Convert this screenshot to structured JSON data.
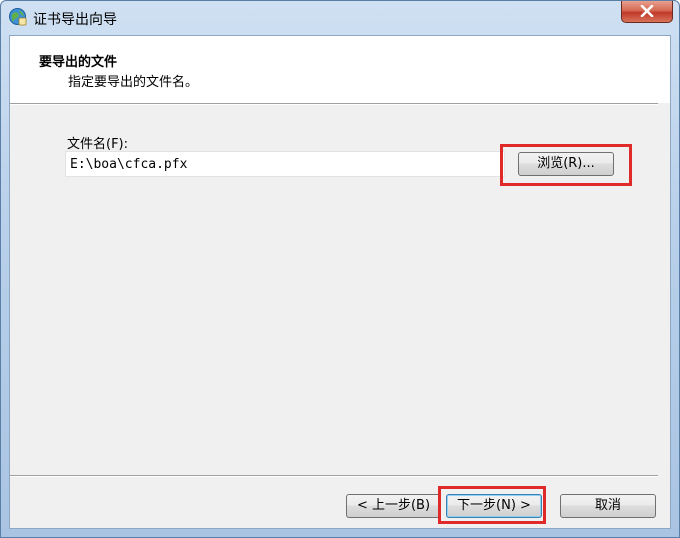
{
  "window": {
    "title": "证书导出向导",
    "icon": "certificate-globe-icon"
  },
  "header": {
    "title": "要导出的文件",
    "subtitle": "指定要导出的文件名。"
  },
  "file_field": {
    "label": "文件名(F):",
    "value": "E:\\boa\\cfca.pfx"
  },
  "buttons": {
    "browse": "浏览(R)...",
    "back": "< 上一步(B)",
    "next": "下一步(N) >",
    "cancel": "取消",
    "close_icon": "close-icon"
  },
  "colors": {
    "highlight": "#e02a2a",
    "close_button": "#c0392b",
    "title_bar": "#b9d1ea"
  }
}
